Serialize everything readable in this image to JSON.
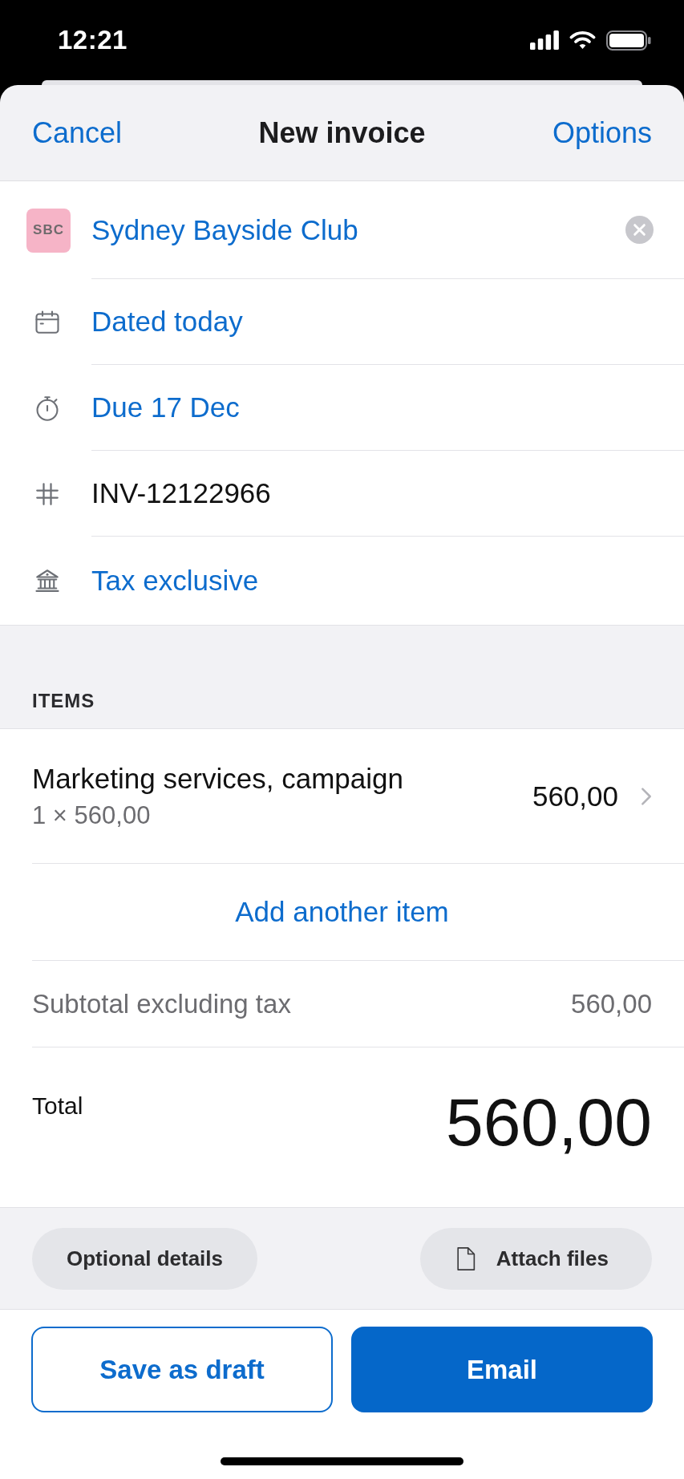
{
  "status_bar": {
    "time": "12:21"
  },
  "nav": {
    "cancel": "Cancel",
    "title": "New invoice",
    "options": "Options"
  },
  "details": {
    "client": {
      "initials": "SBC",
      "name": "Sydney Bayside Club"
    },
    "rows": [
      {
        "kind": "date",
        "text": "Dated today",
        "link": true
      },
      {
        "kind": "due",
        "text": "Due 17 Dec",
        "link": true
      },
      {
        "kind": "number",
        "text": "INV-12122966",
        "link": false
      },
      {
        "kind": "tax",
        "text": "Tax exclusive",
        "link": true
      }
    ]
  },
  "items_section": {
    "heading": "ITEMS",
    "items": [
      {
        "name": "Marketing services, campaign",
        "quantity_line": "1 × 560,00",
        "amount": "560,00"
      }
    ],
    "add_button": "Add another item"
  },
  "subtotal": {
    "label": "Subtotal excluding tax",
    "value": "560,00"
  },
  "total": {
    "label": "Total",
    "value": "560,00"
  },
  "extras": [
    {
      "kind": "plain",
      "label": "Optional details"
    },
    {
      "kind": "attach",
      "label": "Attach files"
    }
  ],
  "actions": [
    {
      "kind": "outline",
      "label": "Save as draft"
    },
    {
      "kind": "primary",
      "label": "Email"
    }
  ]
}
